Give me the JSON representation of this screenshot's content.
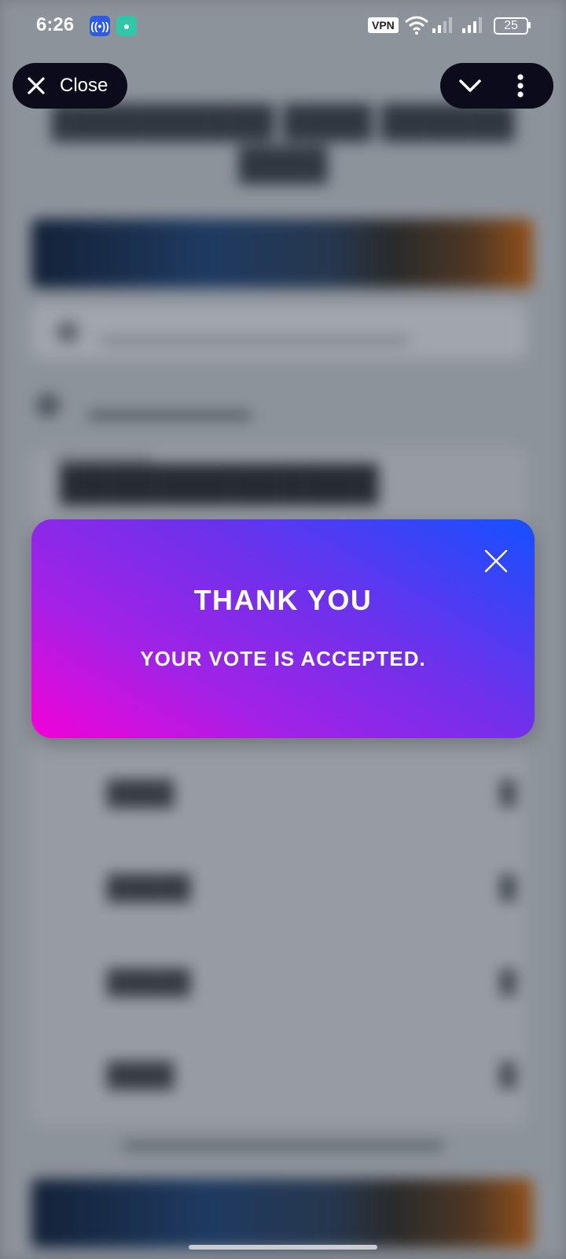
{
  "status_bar": {
    "time": "6:26",
    "vpn": "VPN",
    "battery": "25",
    "icons": [
      "hotspot-icon",
      "chat-icon",
      "wifi-icon",
      "signal-icon"
    ]
  },
  "browser": {
    "close_label": "Close",
    "icons": [
      "close-icon",
      "chevron-down-icon",
      "more-vertical-icon"
    ]
  },
  "modal": {
    "title": "THANK YOU",
    "message": "YOUR VOTE IS ACCEPTED.",
    "gradient_colors": [
      "#f200d6",
      "#6a32ec",
      "#1550ff"
    ]
  }
}
